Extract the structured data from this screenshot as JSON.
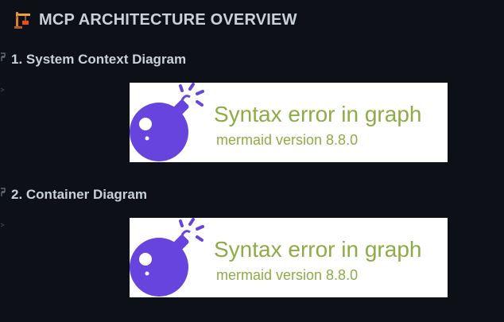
{
  "page": {
    "title": "MCP ARCHITECTURE OVERVIEW",
    "title_icon": "construction-crane-icon"
  },
  "sections": [
    {
      "heading": "1. System Context Diagram",
      "diagram": {
        "icon": "bomb-icon",
        "error_title": "Syntax error in graph",
        "error_version": "mermaid version 8.8.0"
      }
    },
    {
      "heading": "2. Container Diagram",
      "diagram": {
        "icon": "bomb-icon",
        "error_title": "Syntax error in graph",
        "error_version": "mermaid version 8.8.0"
      }
    }
  ],
  "colors": {
    "background": "#0d1017",
    "heading_text": "#c9d1d9",
    "error_text": "#8dab46",
    "bomb": "#6644dd"
  }
}
